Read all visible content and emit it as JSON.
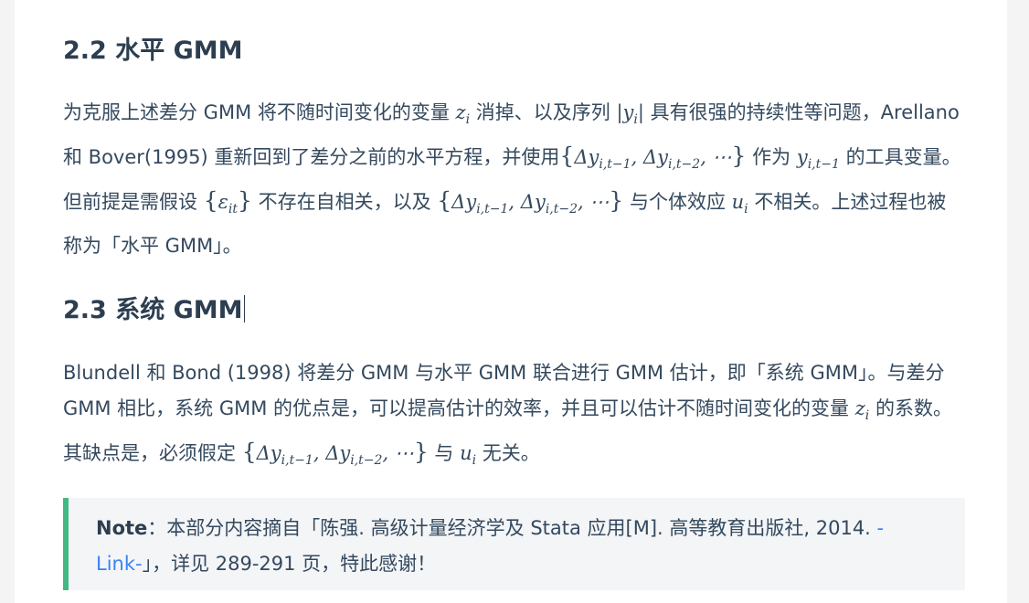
{
  "section_22": {
    "heading": "2.2 水平 GMM",
    "p1_a": "为克服上述差分 GMM 将不随时间变化的变量 ",
    "p1_z": "z",
    "p1_zi": "i",
    "p1_b": " 消掉、以及序列 ",
    "p1_yi": "|y",
    "p1_yi_sub": "i",
    "p1_yi_close": "|",
    "p1_c": " 具有很强的持续性等问题，Arellano 和 Bover(1995) 重新回到了差分之前的水平方程，并使用",
    "p1_set1": "{Δy_{i,t−1}, Δy_{i,t−2}, ⋯}",
    "p1_d": " 作为 ",
    "p1_y": "y",
    "p1_ysub": "i,t−1",
    "p1_e": " 的工具变量。但前提是需假设 ",
    "p1_eps": "{ε_{it}}",
    "p1_f": " 不存在自相关，以及 ",
    "p1_set2": "{Δy_{i,t−1}, Δy_{i,t−2}, ⋯}",
    "p1_g": " 与个体效应 ",
    "p1_u": "u",
    "p1_usub": "i",
    "p1_h": " 不相关。上述过程也被称为「水平 GMM」。"
  },
  "section_23": {
    "heading": "2.3 系统 GMM",
    "p2_a": "Blundell 和 Bond (1998) 将差分 GMM 与水平 GMM 联合进行 GMM 估计，即「系统 GMM」。与差分 GMM 相比，系统 GMM 的优点是，可以提高估计的效率，并且可以估计不随时间变化的变量 ",
    "p2_z": "z",
    "p2_zsub": "i",
    "p2_b": " 的系数。其缺点是，必须假定 ",
    "p2_set": "{Δy_{i,t−1}, Δy_{i,t−2}, ⋯}",
    "p2_c": " 与 ",
    "p2_u": "u",
    "p2_usub": "i",
    "p2_d": " 无关。"
  },
  "note": {
    "label": "Note",
    "text_a": "：本部分内容摘自「陈强. 高级计量经济学及 Stata 应用[M]. 高等教育出版社, 2014. ",
    "link": "-Link-",
    "text_b": "」，详见 289-291 页，特此感谢！"
  },
  "colors": {
    "accent_bar": "#42b983",
    "link": "#3b82f6",
    "text": "#34495e"
  }
}
